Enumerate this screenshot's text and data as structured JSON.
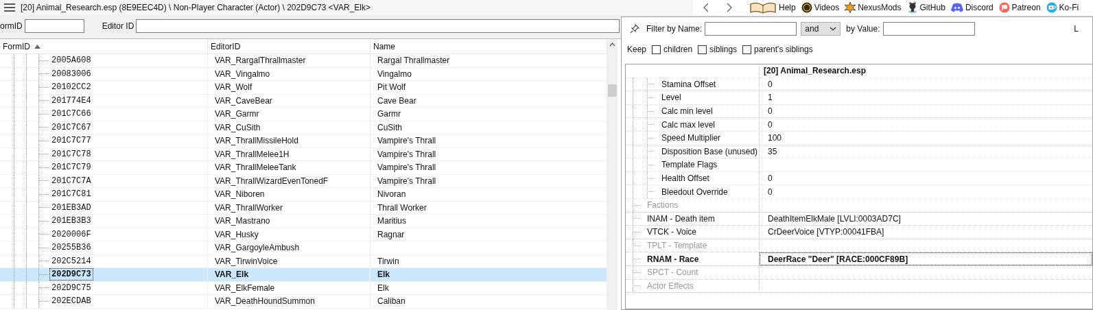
{
  "title_bar": {
    "path": "[20] Animal_Research.esp (8E9EEC4D) \\ Non-Player Character (Actor) \\ 202D9C73 <VAR_Elk>"
  },
  "toolbar": {
    "links": [
      {
        "label": "Help",
        "kind": "book"
      },
      {
        "label": "Videos",
        "kind": "videos"
      },
      {
        "label": "NexusMods",
        "kind": "nexus"
      },
      {
        "label": "GitHub",
        "kind": "github"
      },
      {
        "label": "Discord",
        "kind": "discord"
      },
      {
        "label": "Patreon",
        "kind": "patreon"
      },
      {
        "label": "Ko-Fi",
        "kind": "kofi"
      }
    ]
  },
  "search": {
    "formid_label": "ormID",
    "editorid_label": "Editor ID"
  },
  "record_list": {
    "columns": [
      {
        "label": "FormID",
        "sorted": true
      },
      {
        "label": "EditorID",
        "sorted": false
      },
      {
        "label": "Name",
        "sorted": false
      }
    ],
    "rows": [
      {
        "formid": "2005A608",
        "editor_id": "VAR_RargalThrallmaster",
        "name": "Rargal Thrallmaster",
        "selected": false
      },
      {
        "formid": "20083006",
        "editor_id": "VAR_Vingalmo",
        "name": "Vingalmo",
        "selected": false
      },
      {
        "formid": "20102CC2",
        "editor_id": "VAR_Wolf",
        "name": "Pit Wolf",
        "selected": false
      },
      {
        "formid": "201774E4",
        "editor_id": "VAR_CaveBear",
        "name": "Cave Bear",
        "selected": false
      },
      {
        "formid": "201C7C66",
        "editor_id": "VAR_Garmr",
        "name": "Garmr",
        "selected": false
      },
      {
        "formid": "201C7C67",
        "editor_id": "VAR_CuSith",
        "name": "CuSith",
        "selected": false
      },
      {
        "formid": "201C7C77",
        "editor_id": "VAR_ThrallMissileHold",
        "name": "Vampire's Thrall",
        "selected": false
      },
      {
        "formid": "201C7C78",
        "editor_id": "VAR_ThrallMelee1H",
        "name": "Vampire's Thrall",
        "selected": false
      },
      {
        "formid": "201C7C79",
        "editor_id": "VAR_ThrallMeleeTank",
        "name": "Vampire's Thrall",
        "selected": false
      },
      {
        "formid": "201C7C7A",
        "editor_id": "VAR_ThrallWizardEvenTonedF",
        "name": "Vampire's Thrall",
        "selected": false
      },
      {
        "formid": "201C7C81",
        "editor_id": "VAR_Niboren",
        "name": "Nivoran",
        "selected": false
      },
      {
        "formid": "201EB3AD",
        "editor_id": "VAR_ThrallWorker",
        "name": "Thrall Worker",
        "selected": false
      },
      {
        "formid": "201EB3B3",
        "editor_id": "VAR_Mastrano",
        "name": "Maritius",
        "selected": false
      },
      {
        "formid": "2020006F",
        "editor_id": "VAR_Husky",
        "name": "Ragnar",
        "selected": false
      },
      {
        "formid": "20255B36",
        "editor_id": "VAR_GargoyleAmbush",
        "selected": false
      },
      {
        "formid": "202C5214",
        "editor_id": "VAR_TirwinVoice",
        "name": "Tirwin",
        "selected": false
      },
      {
        "formid": "202D9C73",
        "editor_id": "VAR_Elk",
        "name": "Elk",
        "selected": true
      },
      {
        "formid": "202D9C75",
        "editor_id": "VAR_ElkFemale",
        "name": "Elk",
        "selected": false
      },
      {
        "formid": "202ECDAB",
        "editor_id": "VAR_DeathHoundSummon",
        "name": "Caliban",
        "selected": false
      }
    ]
  },
  "filter": {
    "name_label": "Filter by Name:",
    "operator": "and",
    "value_label": "by Value:",
    "cut_label": "L",
    "keep_label": "Keep",
    "keep_options": [
      {
        "label": "children",
        "checked": false
      },
      {
        "label": "siblings",
        "checked": false
      },
      {
        "label": "parent's siblings",
        "checked": false
      }
    ]
  },
  "record_view": {
    "header": "[20] Animal_Research.esp",
    "rows": [
      {
        "children": [
          {
            "label": "Stamina Offset",
            "value": "0"
          },
          {
            "label": "Level",
            "value": "1"
          },
          {
            "label": "Calc min level",
            "value": "0"
          },
          {
            "label": "Calc max level",
            "value": "0"
          },
          {
            "label": "Speed Multiplier",
            "value": "100"
          },
          {
            "label": "Disposition Base (unused)",
            "value": "35"
          },
          {
            "label": "Template Flags"
          },
          {
            "label": "Health Offset",
            "value": "0"
          },
          {
            "label": "Bleedout Override",
            "value": "0"
          }
        ]
      },
      {
        "label": "Factions",
        "selected": false,
        "disabled": true
      },
      {
        "label": "INAM - Death item",
        "value": "DeathItemElkMale [LVLI:0003AD7C]",
        "selected": false,
        "disabled": false
      },
      {
        "label": "VTCK - Voice",
        "value": "CrDeerVoice [VTYP:00041FBA]",
        "selected": false,
        "disabled": false
      },
      {
        "label": "TPLT - Template",
        "selected": false,
        "disabled": true
      },
      {
        "label": "RNAM - Race",
        "value": "DeerRace \"Deer\" [RACE:000CF89B]",
        "selected": true,
        "disabled": false
      },
      {
        "label": "SPCT - Count",
        "selected": false,
        "disabled": true
      },
      {
        "label": "Actor Effects",
        "selected": false,
        "disabled": true
      }
    ]
  }
}
